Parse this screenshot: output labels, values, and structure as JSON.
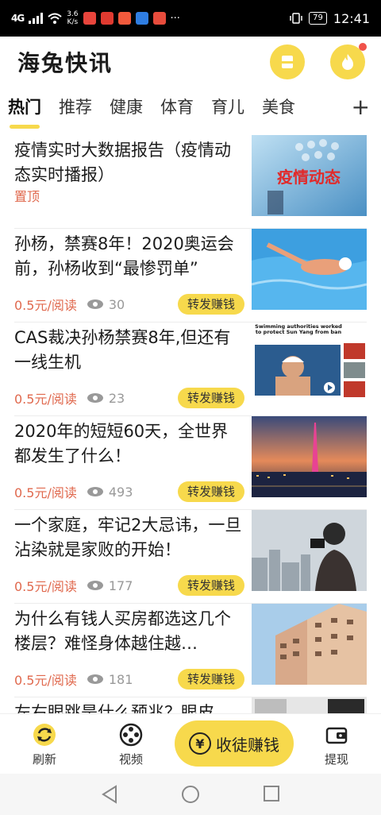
{
  "status_bar": {
    "signal": "4G",
    "speed": "3.6\nK/s",
    "battery": "79",
    "time": "12:41",
    "dots": "···"
  },
  "header": {
    "title": "海兔快讯",
    "box_icon": "inbox-icon",
    "fire_icon": "fire-icon"
  },
  "tabs": [
    {
      "label": "热门",
      "active": true
    },
    {
      "label": "推荐"
    },
    {
      "label": "健康"
    },
    {
      "label": "体育"
    },
    {
      "label": "育儿"
    },
    {
      "label": "美食"
    }
  ],
  "tab_add": "+",
  "feed": [
    {
      "title": "疫情实时大数据报告（疫情动态实时播报）",
      "pinned": "置顶",
      "thumb_text": "疫情动态"
    },
    {
      "title": "孙杨，禁赛8年！2020奥运会前，孙杨收到“最惨罚单”",
      "price": "0.5元/阅读",
      "views": "30",
      "share": "转发赚钱"
    },
    {
      "title": "CAS裁决孙杨禁赛8年,但还有一线生机",
      "price": "0.5元/阅读",
      "views": "23",
      "share": "转发赚钱",
      "thumb_headline": "Swimming authorities worked to protect Sun Yang from ban"
    },
    {
      "title": "2020年的短短60天，全世界都发生了什么！",
      "price": "0.5元/阅读",
      "views": "493",
      "share": "转发赚钱"
    },
    {
      "title": "一个家庭，牢记2大忌讳，一旦沾染就是家败的开始！",
      "price": "0.5元/阅读",
      "views": "177",
      "share": "转发赚钱"
    },
    {
      "title": "为什么有钱人买房都选这几个楼层？难怪身体越住越…",
      "price": "0.5元/阅读",
      "views": "181",
      "share": "转发赚钱"
    },
    {
      "title": "左右眼跳是什么预兆？眼皮"
    }
  ],
  "bottom_nav": {
    "refresh": "刷新",
    "video": "视频",
    "recruit": "收徒赚钱",
    "withdraw": "提现"
  },
  "colors": {
    "accent": "#f7d94c",
    "price": "#e0694e"
  }
}
